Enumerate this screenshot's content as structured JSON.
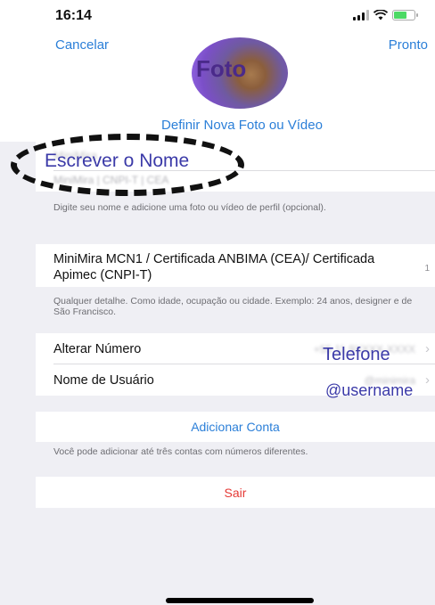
{
  "status_bar": {
    "time": "16:14"
  },
  "nav": {
    "cancel_label": "Cancelar",
    "done_label": "Pronto"
  },
  "profile": {
    "photo_annotation": "Foto",
    "define_photo_label": "Definir Nova Foto ou Vídeo",
    "name_value": "MiniMira",
    "lastname_value": "MiniMira | CNPI-T | CEA",
    "name_annotation": "Escrever o Nome",
    "name_hint": "Digite seu nome e adicione uma foto ou vídeo de perfil (opcional)."
  },
  "bio": {
    "text": "MiniMira MCN1 / Certificada ANBIMA (CEA)/ Certificada Apimec (CNPI-T)",
    "char_count": "1",
    "hint": "Qualquer detalhe. Como idade, ocupação ou cidade. Exemplo: 24 anos, designer e de São Francisco."
  },
  "account": {
    "change_number_label": "Alterar Número",
    "phone_value": "+55 11 9XXXX-XXXX",
    "phone_annotation": "Telefone",
    "username_label": "Nome de Usuário",
    "username_value": "@minimira",
    "username_annotation": "@username"
  },
  "add_account": {
    "label": "Adicionar Conta",
    "hint": "Você pode adicionar até três contas com números diferentes."
  },
  "logout": {
    "label": "Sair"
  },
  "colors": {
    "accent": "#2b7fd8",
    "destructive": "#e53935",
    "annotation": "#3b3aa8",
    "background": "#efeff4"
  },
  "icons": {
    "signal": "signal-icon",
    "wifi": "wifi-icon",
    "battery": "battery-icon",
    "chevron": "chevron-right-icon"
  }
}
